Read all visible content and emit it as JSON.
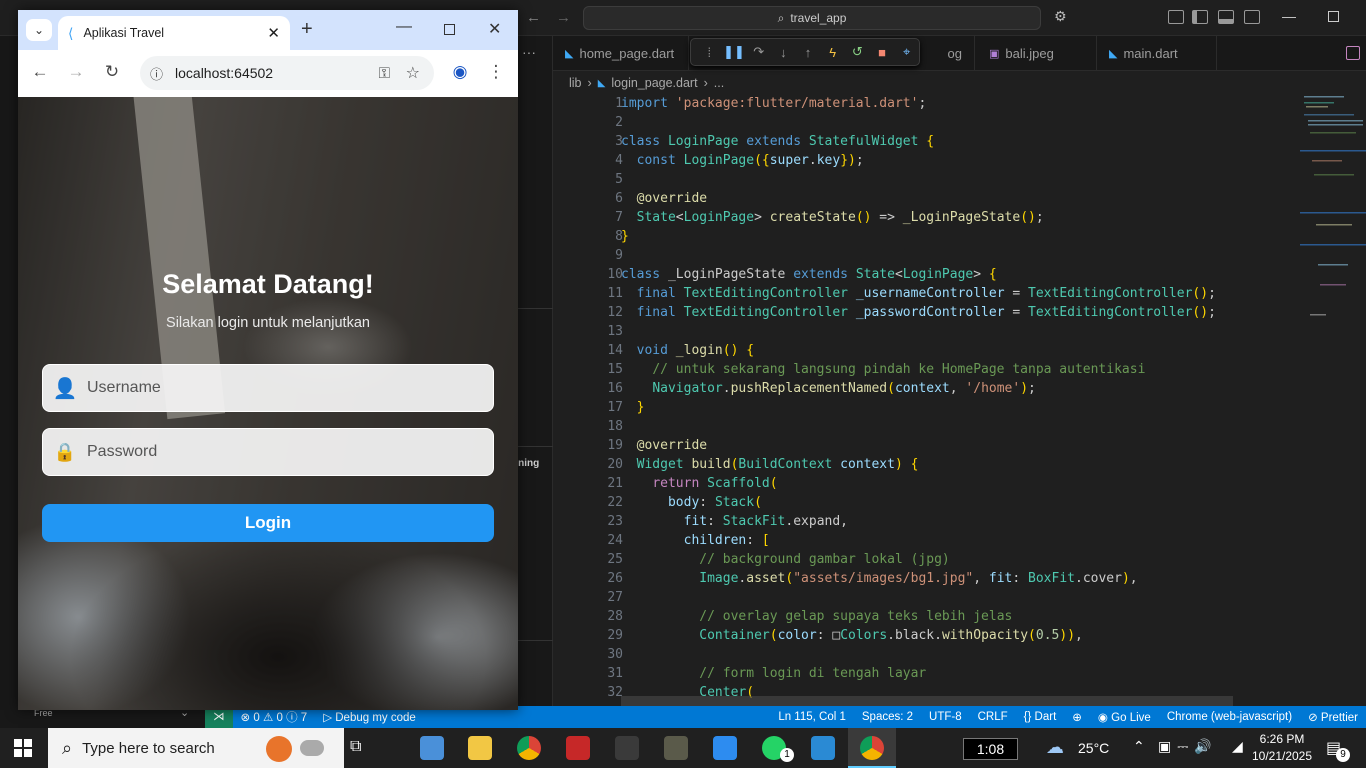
{
  "vscode": {
    "search_text": "travel_app",
    "tabs": [
      {
        "label": "home_page.dart",
        "icon": "dart-icon"
      },
      {
        "label": "og",
        "icon": "image-icon"
      },
      {
        "label": "bali.jpeg",
        "icon": "image-icon"
      },
      {
        "label": "main.dart",
        "icon": "dart-icon"
      }
    ],
    "breadcrumb": {
      "folder": "lib",
      "file": "login_page.dart",
      "more": "..."
    },
    "line_numbers": [
      "1",
      "2",
      "3",
      "4",
      "5",
      "6",
      "7",
      "8",
      "9",
      "10",
      "11",
      "12",
      "13",
      "14",
      "15",
      "16",
      "17",
      "18",
      "19",
      "20",
      "21",
      "22",
      "23",
      "24",
      "25",
      "26",
      "27",
      "28",
      "29",
      "30",
      "31",
      "32"
    ],
    "code_lines": [
      "import 'package:flutter/material.dart';",
      "",
      "class LoginPage extends StatefulWidget {",
      "  const LoginPage({super.key});",
      "",
      "  @override",
      "  State<LoginPage> createState() => _LoginPageState();",
      "}",
      "",
      "class _LoginPageState extends State<LoginPage> {",
      "  final TextEditingController _usernameController = TextEditingController();",
      "  final TextEditingController _passwordController = TextEditingController();",
      "",
      "  void _login() {",
      "    // untuk sekarang langsung pindah ke HomePage tanpa autentikasi",
      "    Navigator.pushReplacementNamed(context, '/home');",
      "  }",
      "",
      "  @override",
      "  Widget build(BuildContext context) {",
      "    return Scaffold(",
      "      body: Stack(",
      "        fit: StackFit.expand,",
      "        children: [",
      "          // background gambar lokal (jpg)",
      "          Image.asset(\"assets/images/bg1.jpg\", fit: BoxFit.cover),",
      "",
      "          // overlay gelap supaya teks lebih jelas",
      "          Container(color: □Colors.black.withOpacity(0.5)),",
      "",
      "          // form login di tengah layar",
      "          Center("
    ],
    "left_panel_text": "nning",
    "status": {
      "errors": "0",
      "warnings": "0",
      "info": "7",
      "debug": "Debug my code",
      "position": "Ln 115, Col 1",
      "spaces": "Spaces: 2",
      "encoding": "UTF-8",
      "eol": "CRLF",
      "language": "Dart",
      "golive": "Go Live",
      "device": "Chrome (web-javascript)",
      "prettier": "Prettier"
    },
    "colors": {
      "keyword": "#569cd6",
      "control": "#c586c0",
      "type": "#4ec9b0",
      "function": "#dcdcaa",
      "string": "#ce9178",
      "comment": "#6a9955",
      "variable": "#9cdcfe",
      "number": "#b5cea8",
      "status": "#0078d4"
    }
  },
  "chrome": {
    "tab_title": "Aplikasi Travel",
    "url": "localhost:64502",
    "page": {
      "title": "Selamat Datang!",
      "subtitle": "Silakan login untuk melanjutkan",
      "username_placeholder": "Username",
      "password_placeholder": "Password",
      "login_label": "Login",
      "button_color": "#2196f3"
    }
  },
  "taskbar": {
    "search_placeholder": "Type here to search",
    "timer": "1:08",
    "weather": "25°C",
    "time": "6:26 PM",
    "date": "10/21/2025",
    "notifications": "9",
    "whatsapp_badge": "1",
    "free_label": "Free"
  }
}
